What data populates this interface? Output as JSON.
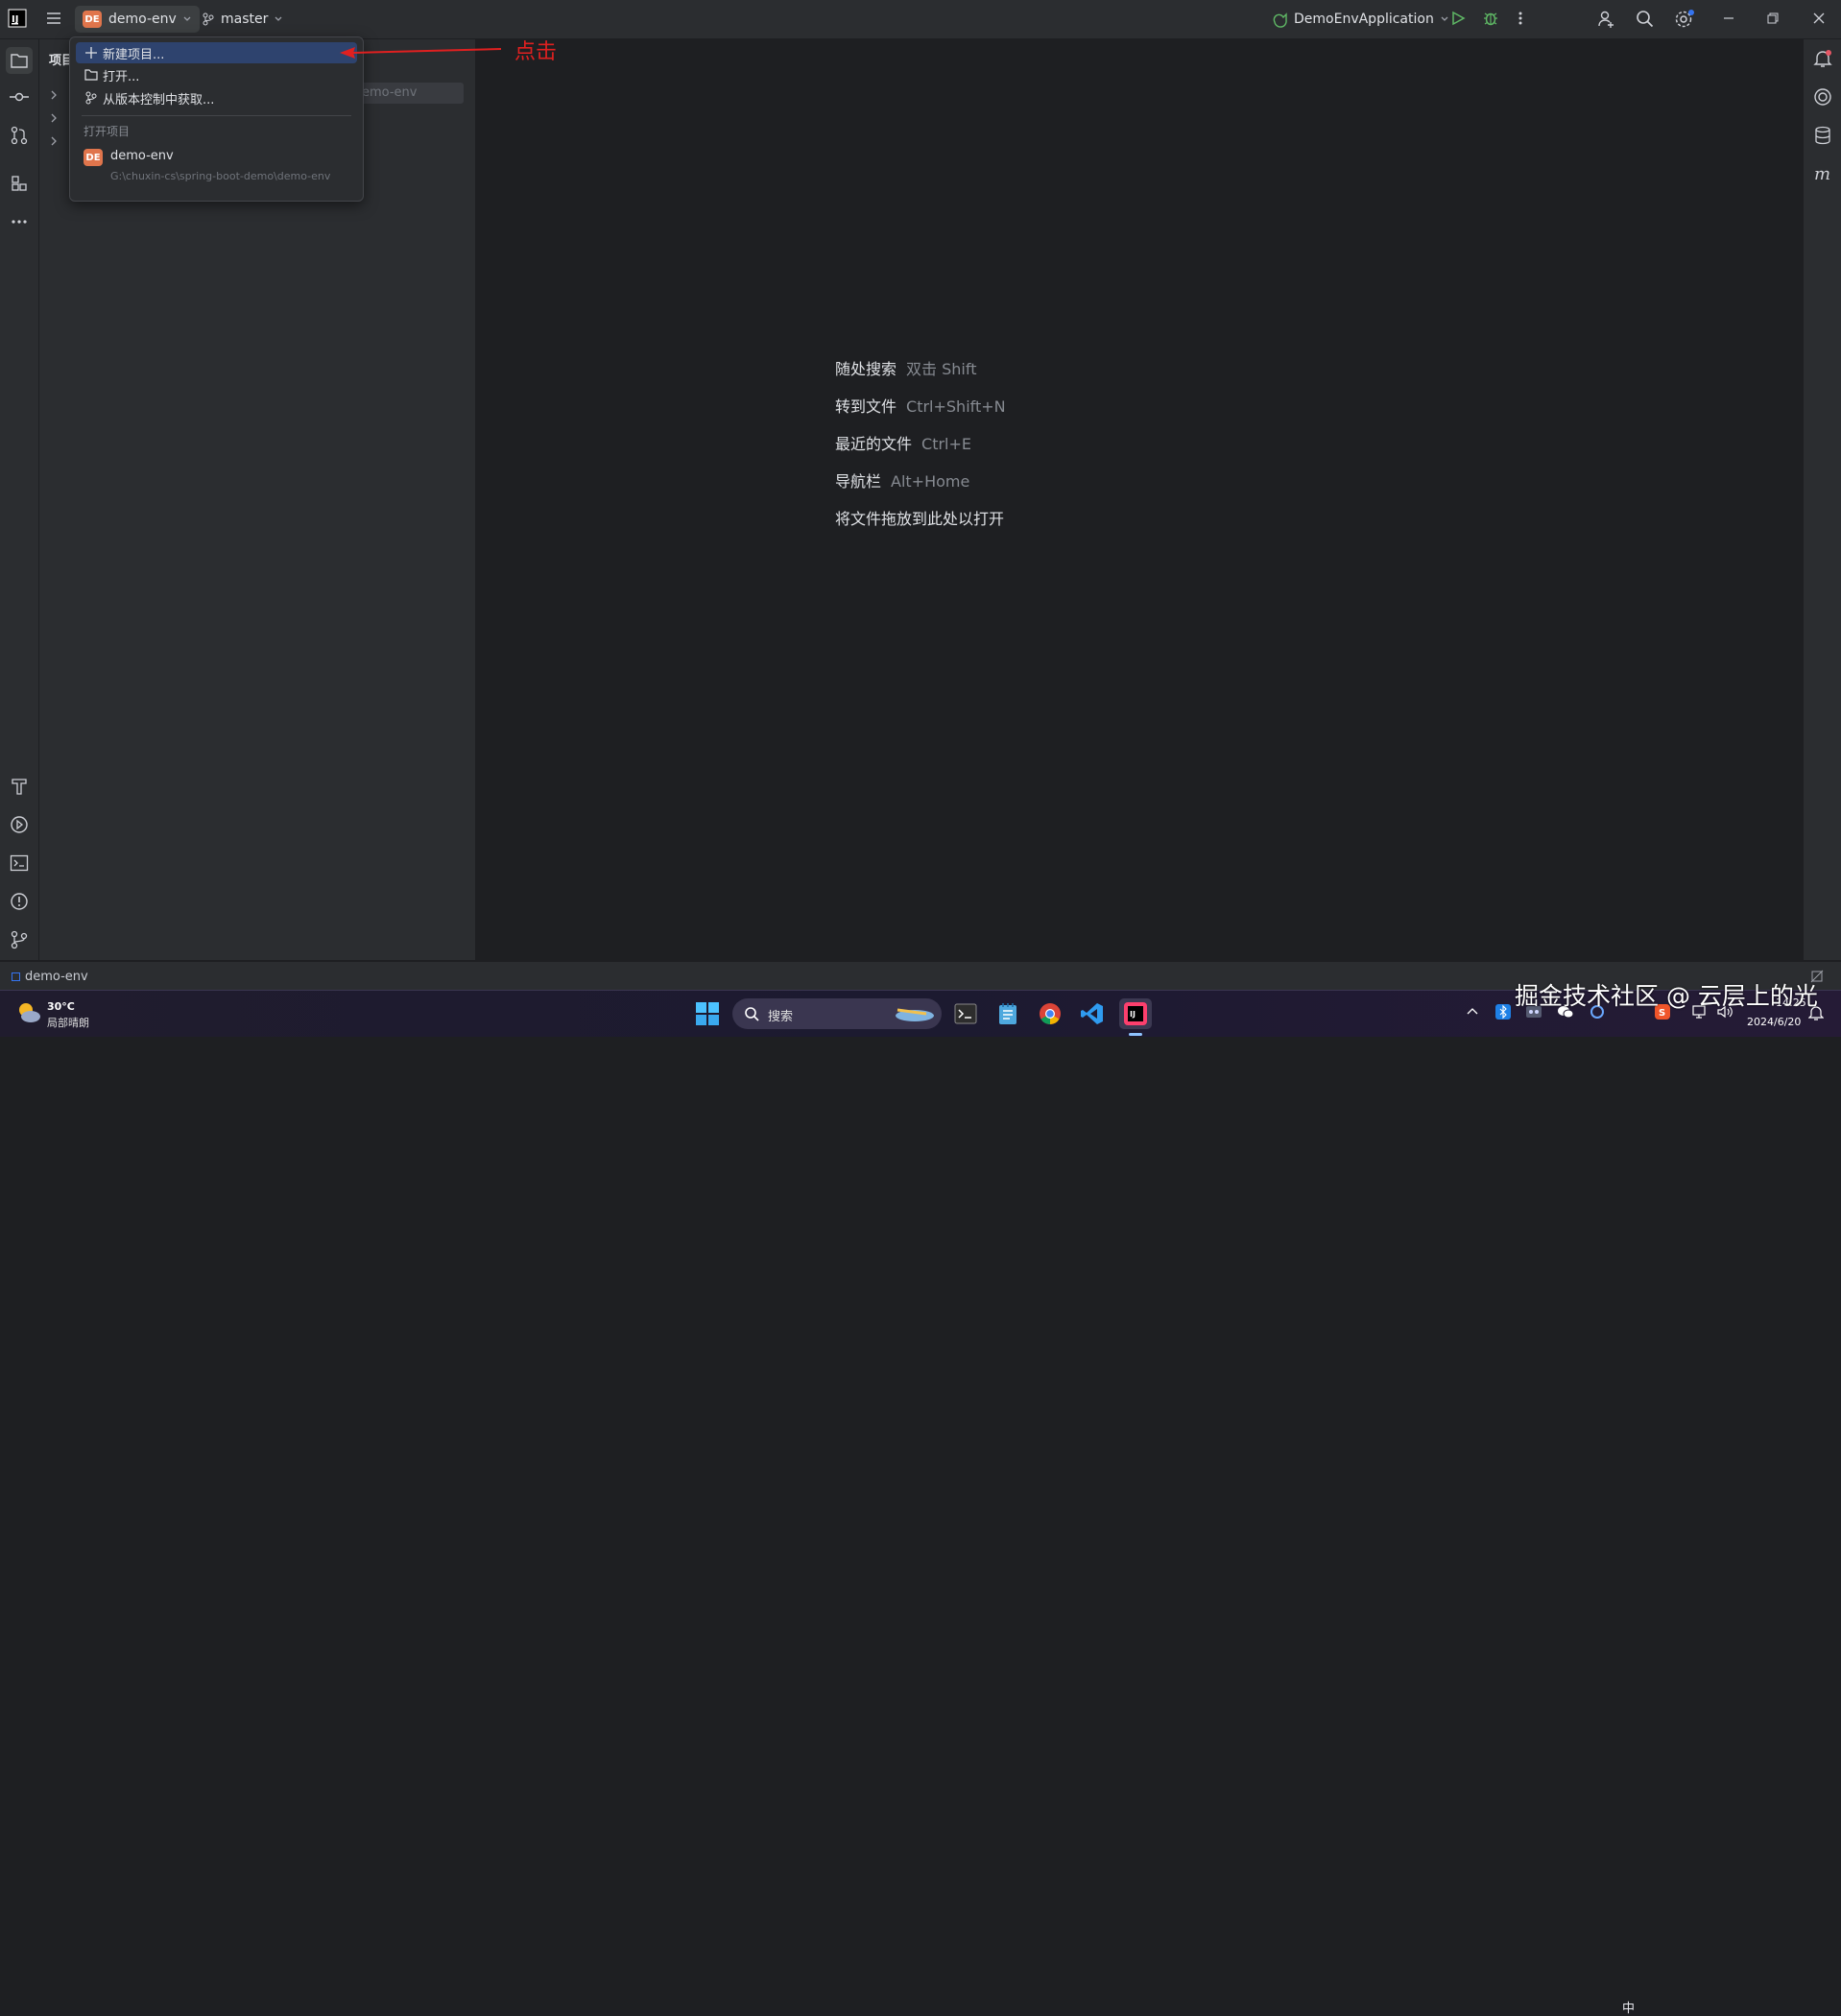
{
  "titlebar": {
    "project_badge": "DE",
    "project_name": "demo-env",
    "branch": "master",
    "run_config": "DemoEnvApplication"
  },
  "project_panel": {
    "title": "项目",
    "path_field": "emo-env"
  },
  "project_menu": {
    "items": [
      {
        "label": "新建项目...",
        "icon": "plus-icon"
      },
      {
        "label": "打开...",
        "icon": "folder-icon"
      },
      {
        "label": "从版本控制中获取...",
        "icon": "vcs-icon"
      }
    ],
    "recent_title": "打开项目",
    "recent": [
      {
        "badge": "DE",
        "name": "demo-env",
        "path": "G:\\chuxin-cs\\spring-boot-demo\\demo-env"
      }
    ]
  },
  "annotation": {
    "text": "点击",
    "color": "#e02020"
  },
  "editor_hints": [
    {
      "label": "随处搜索",
      "shortcut": "双击 Shift"
    },
    {
      "label": "转到文件",
      "shortcut": "Ctrl+Shift+N"
    },
    {
      "label": "最近的文件",
      "shortcut": "Ctrl+E"
    },
    {
      "label": "导航栏",
      "shortcut": "Alt+Home"
    },
    {
      "label": "将文件拖放到此处以打开",
      "shortcut": ""
    }
  ],
  "statusbar": {
    "project": "demo-env"
  },
  "taskbar": {
    "weather_temp": "30°C",
    "weather_desc": "局部晴朗",
    "search_placeholder": "搜索",
    "ime": "中",
    "time": "14:25",
    "date": "2024/6/20"
  },
  "watermark": "掘金技术社区 @ 云层上的光",
  "colors": {
    "accent": "#2e436e",
    "badge": "#e0754c",
    "run_green": "#5fb865"
  }
}
